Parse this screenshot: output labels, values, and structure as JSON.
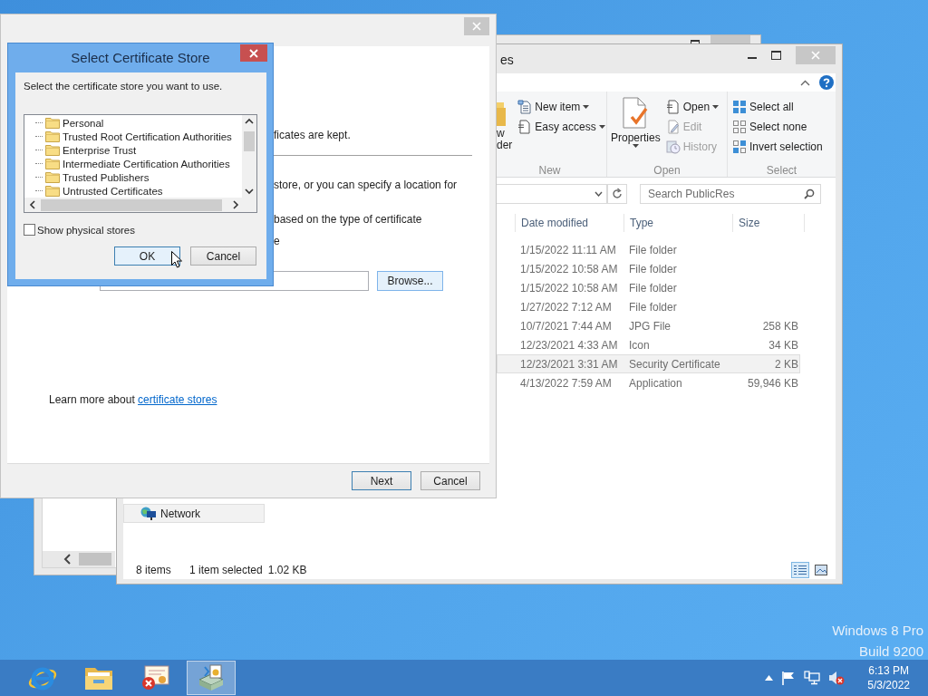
{
  "desktop": {
    "watermark": [
      "Windows 8 Pro",
      "Build 9200"
    ]
  },
  "explorer": {
    "title": "es",
    "ribbon_groups": [
      {
        "label": "New",
        "items": [
          {
            "kind": "large",
            "lines": [
              "w",
              "der"
            ],
            "disabled": false,
            "dropdown": false
          },
          {
            "kind": "small",
            "label": "New item",
            "disabled": false,
            "dropdown": true
          },
          {
            "kind": "small",
            "label": "Easy access",
            "disabled": false,
            "dropdown": true
          }
        ]
      },
      {
        "label": "Open",
        "items": [
          {
            "kind": "large",
            "lines": [
              "Properties"
            ],
            "disabled": false,
            "dropdown": true
          },
          {
            "kind": "small",
            "label": "Open",
            "disabled": false,
            "dropdown": true
          },
          {
            "kind": "small",
            "label": "Edit",
            "disabled": true,
            "dropdown": false
          },
          {
            "kind": "small",
            "label": "History",
            "disabled": true,
            "dropdown": false
          }
        ]
      },
      {
        "label": "Select",
        "items": [
          {
            "kind": "small",
            "label": "Select all",
            "disabled": false,
            "dropdown": false
          },
          {
            "kind": "small",
            "label": "Select none",
            "disabled": false,
            "dropdown": false
          },
          {
            "kind": "small",
            "label": "Invert selection",
            "disabled": false,
            "dropdown": false
          }
        ]
      }
    ],
    "search": {
      "placeholder": "Search PublicRes"
    },
    "nav": [
      {
        "label": "Network",
        "selected": true
      }
    ],
    "columns": [
      "Date modified",
      "Type",
      "Size"
    ],
    "rows": [
      {
        "date": "1/15/2022 11:11 AM",
        "type": "File folder",
        "selected": false
      },
      {
        "date": "1/15/2022 10:58 AM",
        "type": "File folder",
        "selected": false
      },
      {
        "date": "1/15/2022 10:58 AM",
        "type": "File folder",
        "selected": false
      },
      {
        "date": "1/27/2022 7:12 AM",
        "type": "File folder",
        "selected": false
      },
      {
        "date": "10/7/2021 7:44 AM",
        "type": "JPG File",
        "size": "258 KB",
        "selected": false
      },
      {
        "date": "12/23/2021 4:33 AM",
        "type": "Icon",
        "size": "34 KB",
        "selected": false
      },
      {
        "date": "12/23/2021 3:31 AM",
        "type": "Security Certificate",
        "size": "2 KB",
        "selected": true
      },
      {
        "date": "4/13/2022 7:59 AM",
        "type": "Application",
        "size": "59,946 KB",
        "selected": false
      }
    ],
    "status": {
      "count": "8 items",
      "selection": "1 item selected",
      "size": "1.02 KB"
    },
    "view_buttons": [
      {
        "kind": "details",
        "selected": true
      },
      {
        "kind": "large_icons",
        "selected": false
      }
    ]
  },
  "wizard": {
    "fragments": [
      "ficates are kept.",
      "store, or you can specify a location for",
      "based on the type of certificate",
      "e"
    ],
    "browse_button": "Browse...",
    "learn_more": {
      "text": "Learn more about",
      "link": "certificate stores"
    },
    "buttons": [
      {
        "label": "Next",
        "default": true
      },
      {
        "label": "Cancel",
        "default": false
      }
    ]
  },
  "dialog": {
    "title": "Select Certificate Store",
    "prompt": "Select the certificate store you want to use.",
    "stores": [
      {
        "label": "Personal",
        "selected": false
      },
      {
        "label": "Trusted Root Certification Authorities",
        "selected": false
      },
      {
        "label": "Enterprise Trust",
        "selected": false
      },
      {
        "label": "Intermediate Certification Authorities",
        "selected": false
      },
      {
        "label": "Trusted Publishers",
        "selected": false
      },
      {
        "label": "Untrusted Certificates",
        "selected": false
      }
    ],
    "show_physical_stores": {
      "label": "Show physical stores",
      "checked": false
    },
    "buttons": [
      {
        "label": "OK",
        "default": true
      },
      {
        "label": "Cancel",
        "default": false
      }
    ]
  },
  "taskbar": {
    "items": [
      {
        "kind": "browser",
        "active": false
      },
      {
        "kind": "folder",
        "active": false
      },
      {
        "kind": "certificate",
        "active": false
      },
      {
        "kind": "installer",
        "active": true
      }
    ],
    "time": "6:13 PM",
    "date": "5/3/2022"
  }
}
